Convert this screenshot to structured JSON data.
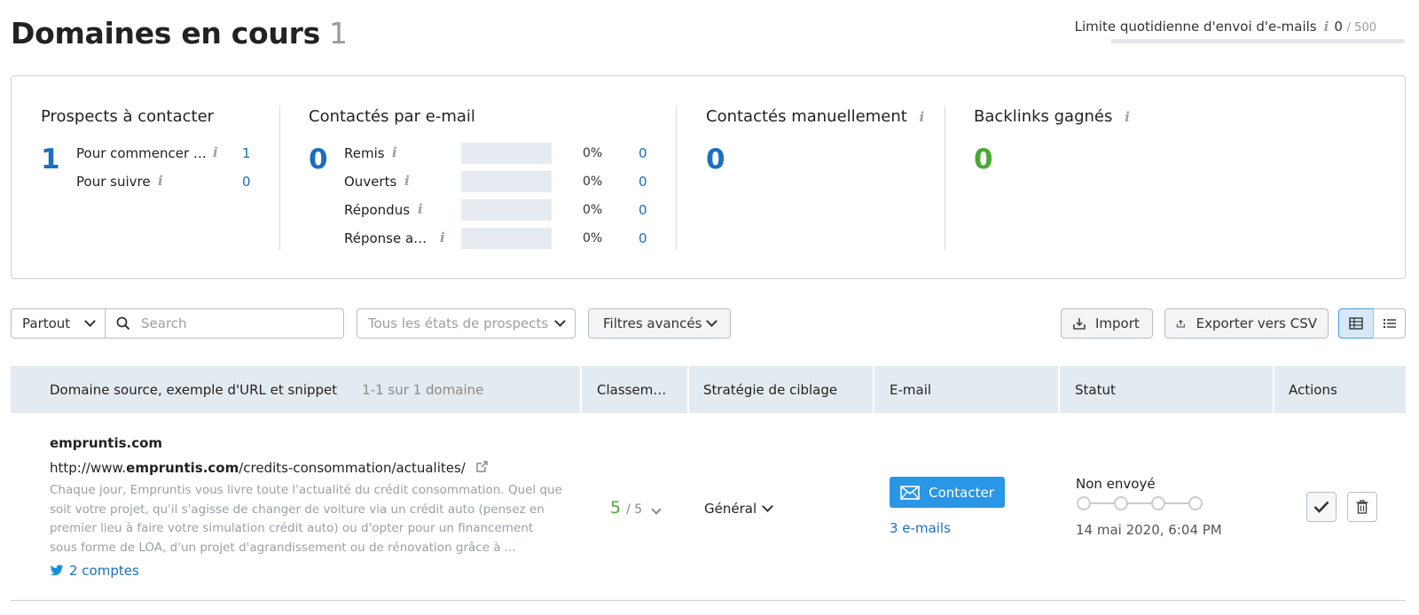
{
  "header": {
    "title": "Domaines en cours",
    "count": "1",
    "limit_label": "Limite quotidienne d'envoi d'e-mails",
    "limit_used": "0",
    "limit_total": "500",
    "limit_fill": 0
  },
  "stats": {
    "prospects": {
      "title": "Prospects à contacter",
      "total": "1",
      "rows": [
        {
          "label": "Pour commencer …",
          "value": "1"
        },
        {
          "label": "Pour suivre",
          "value": "0"
        }
      ]
    },
    "email": {
      "title": "Contactés par e-mail",
      "total": "0",
      "rows": [
        {
          "label": "Remis",
          "percent": "0%",
          "value": "0",
          "fill": 0
        },
        {
          "label": "Ouverts",
          "percent": "0%",
          "value": "0",
          "fill": 0
        },
        {
          "label": "Répondus",
          "percent": "0%",
          "value": "0",
          "fill": 0
        },
        {
          "label": "Réponse a…",
          "percent": "0%",
          "value": "0",
          "fill": 0
        }
      ]
    },
    "manual": {
      "title": "Contactés manuellement",
      "total": "0"
    },
    "backlinks": {
      "title": "Backlinks gagnés",
      "total": "0"
    }
  },
  "toolbar": {
    "scope": "Partout",
    "search_placeholder": "Search",
    "states": "Tous les états de prospects",
    "filters": "Filtres avancés",
    "import": "Import",
    "export": "Exporter vers CSV"
  },
  "table": {
    "columns": {
      "source": "Domaine source, exemple d'URL et snippet",
      "source_count": "1-1 sur 1 domaine",
      "rank": "Classem…",
      "strategy": "Stratégie de ciblage",
      "email": "E-mail",
      "status": "Statut",
      "actions": "Actions"
    },
    "row": {
      "domain": "empruntis.com",
      "url_prefix": "http://www.",
      "url_domain": "empruntis.com",
      "url_path": "/credits-consommation/actualites/",
      "snippet": "Chaque jour, Empruntis vous livre toute l'actualité du crédit consommation. Quel que soit votre projet, qu'il s'agisse de changer de voiture via un crédit auto (pensez en premier lieu à faire votre simulation crédit auto) ou d'opter pour un financement sous forme de LOA, d'un projet d'agrandissement ou de rénovation grâce à ...",
      "accounts": "2 comptes",
      "rank": "5",
      "rank_max": "/ 5",
      "strategy": "Général",
      "contact_label": "Contacter",
      "emails_link": "3 e-mails",
      "status": "Non envoyé",
      "date": "14 mai 2020, 6:04 PM"
    }
  },
  "colors": {
    "accent_blue": "#1a6fbf",
    "button_blue": "#2a96e6",
    "success_green": "#4ba834",
    "warning_orange": "#e8731c"
  }
}
